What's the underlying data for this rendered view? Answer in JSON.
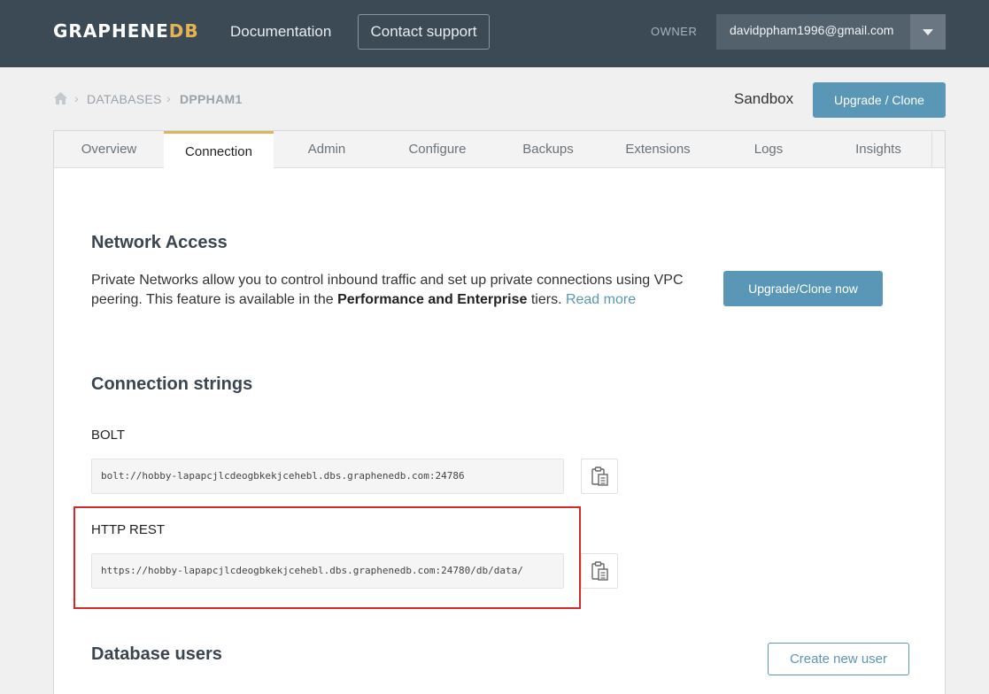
{
  "header": {
    "logo_main": "GRAPHENE",
    "logo_accent": "DB",
    "nav_documentation": "Documentation",
    "nav_contact_support": "Contact support",
    "owner_label": "OWNER",
    "account_email": "davidppham1996@gmail.com"
  },
  "breadcrumb": {
    "items": [
      "DATABASES",
      "DPPHAM1"
    ]
  },
  "plan": {
    "label": "Sandbox",
    "upgrade_button": "Upgrade / Clone"
  },
  "tabs": [
    "Overview",
    "Connection",
    "Admin",
    "Configure",
    "Backups",
    "Extensions",
    "Logs",
    "Insights"
  ],
  "active_tab": "Connection",
  "network_access": {
    "title": "Network Access",
    "text_before": "Private Networks allow you to control inbound traffic and set up private connections using VPC peering. This feature is available in the ",
    "text_bold": "Performance and Enterprise",
    "text_after": " tiers. ",
    "link": "Read more",
    "button": "Upgrade/Clone now"
  },
  "connection_strings": {
    "title": "Connection strings",
    "bolt_label": "BOLT",
    "bolt_value": "bolt://hobby-lapapcjlcdeogbkekjcehebl.dbs.graphenedb.com:24786",
    "http_label": "HTTP REST",
    "http_value": "https://hobby-lapapcjlcdeogbkekjcehebl.dbs.graphenedb.com:24780/db/data/"
  },
  "database_users": {
    "title": "Database users",
    "create_button": "Create new user"
  },
  "colors": {
    "header_bg": "#3c4a56",
    "accent_gold": "#e5b452",
    "primary_blue": "#5a97b7",
    "highlight_red": "#d62828"
  },
  "icons": {
    "home": "home-icon",
    "copy": "clipboard-icon",
    "dropdown": "chevron-down-icon"
  }
}
